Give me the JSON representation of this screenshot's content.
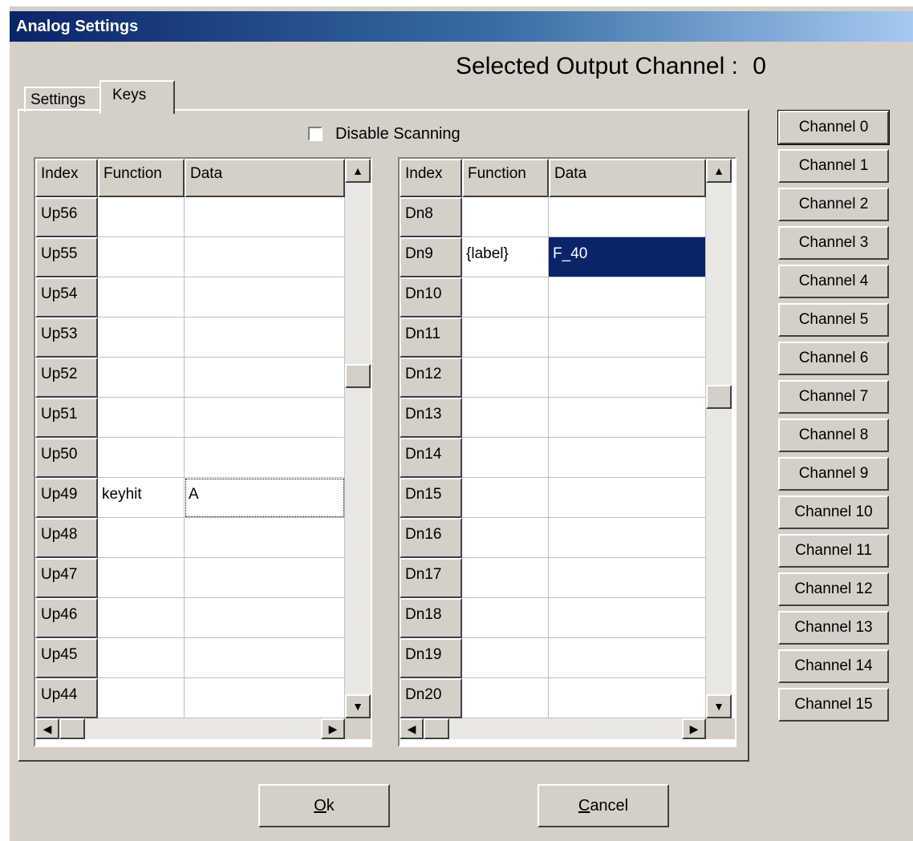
{
  "window": {
    "title": "Analog Settings"
  },
  "header": {
    "selected_channel_label": "Selected Output Channel :",
    "selected_channel_value": "0"
  },
  "tabs": [
    {
      "label": "Settings"
    },
    {
      "label": "Keys"
    }
  ],
  "options": {
    "disable_scanning_label": "Disable Scanning",
    "disable_scanning_checked": false
  },
  "left_grid": {
    "columns": [
      "Index",
      "Function",
      "Data"
    ],
    "rows": [
      {
        "index": "Up56",
        "function": "",
        "data": ""
      },
      {
        "index": "Up55",
        "function": "",
        "data": ""
      },
      {
        "index": "Up54",
        "function": "",
        "data": ""
      },
      {
        "index": "Up53",
        "function": "",
        "data": ""
      },
      {
        "index": "Up52",
        "function": "",
        "data": ""
      },
      {
        "index": "Up51",
        "function": "",
        "data": ""
      },
      {
        "index": "Up50",
        "function": "",
        "data": ""
      },
      {
        "index": "Up49",
        "function": "keyhit",
        "data": "A"
      },
      {
        "index": "Up48",
        "function": "",
        "data": ""
      },
      {
        "index": "Up47",
        "function": "",
        "data": ""
      },
      {
        "index": "Up46",
        "function": "",
        "data": ""
      },
      {
        "index": "Up45",
        "function": "",
        "data": ""
      },
      {
        "index": "Up44",
        "function": "",
        "data": ""
      }
    ]
  },
  "right_grid": {
    "columns": [
      "Index",
      "Function",
      "Data"
    ],
    "rows": [
      {
        "index": "Dn8",
        "function": "",
        "data": ""
      },
      {
        "index": "Dn9",
        "function": "{label}",
        "data": "F_40"
      },
      {
        "index": "Dn10",
        "function": "",
        "data": ""
      },
      {
        "index": "Dn11",
        "function": "",
        "data": ""
      },
      {
        "index": "Dn12",
        "function": "",
        "data": ""
      },
      {
        "index": "Dn13",
        "function": "",
        "data": ""
      },
      {
        "index": "Dn14",
        "function": "",
        "data": ""
      },
      {
        "index": "Dn15",
        "function": "",
        "data": ""
      },
      {
        "index": "Dn16",
        "function": "",
        "data": ""
      },
      {
        "index": "Dn17",
        "function": "",
        "data": ""
      },
      {
        "index": "Dn18",
        "function": "",
        "data": ""
      },
      {
        "index": "Dn19",
        "function": "",
        "data": ""
      },
      {
        "index": "Dn20",
        "function": "",
        "data": ""
      }
    ]
  },
  "channels": [
    "Channel 0",
    "Channel 1",
    "Channel 2",
    "Channel 3",
    "Channel 4",
    "Channel 5",
    "Channel 6",
    "Channel 7",
    "Channel 8",
    "Channel 9",
    "Channel 10",
    "Channel 11",
    "Channel 12",
    "Channel 13",
    "Channel 14",
    "Channel 15"
  ],
  "buttons": {
    "ok_mnemonic": "O",
    "ok_rest": "k",
    "cancel_mnemonic": "C",
    "cancel_rest": "ancel"
  },
  "colors": {
    "title_start": "#0a246a",
    "title_end": "#a6caf0",
    "face": "#d4d0c8",
    "selection": "#0a246a"
  },
  "icons": {
    "scroll_up": "▲",
    "scroll_down": "▼",
    "scroll_left": "◀",
    "scroll_right": "▶"
  }
}
